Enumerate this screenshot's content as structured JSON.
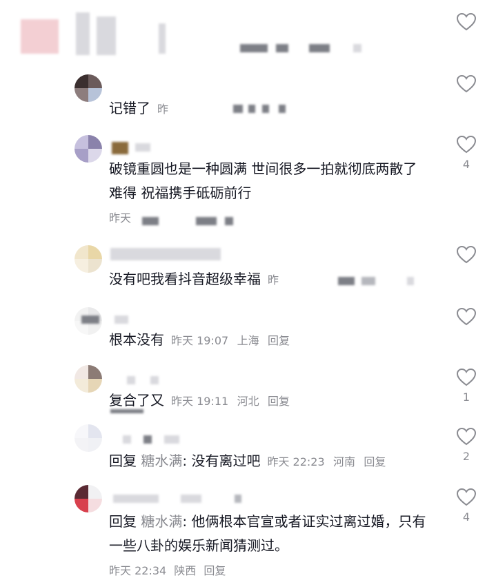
{
  "comments": [
    {
      "text": "记错了",
      "time": "昨",
      "likes": ""
    },
    {
      "text": "破镜重圆也是一种圆满 世间很多一拍就彻底两散了 难得 祝福携手砥砺前行",
      "time": "昨天",
      "likes": "4"
    },
    {
      "text": "没有吧我看抖音超级幸福",
      "time": "昨",
      "likes": ""
    },
    {
      "text": "根本没有",
      "time": "昨天 19:07",
      "location": "上海",
      "reply": "回复",
      "likes": ""
    },
    {
      "text": "复合了又",
      "time": "昨天 19:11",
      "location": "河北",
      "reply": "回复",
      "likes": "1"
    },
    {
      "reply_prefix": "回复",
      "mention": "糖水满",
      "text": ": 没有离过吧",
      "time": "昨天 22:23",
      "location": "河南",
      "reply": "回复",
      "likes": "2"
    },
    {
      "reply_prefix": "回复",
      "mention": "糖水满",
      "text": ": 他俩根本官宣或者证实过离过婚，只有一些八卦的娱乐新闻猜测过。",
      "time": "昨天 22:34",
      "location": "陕西",
      "reply": "回复",
      "likes": "4"
    }
  ]
}
